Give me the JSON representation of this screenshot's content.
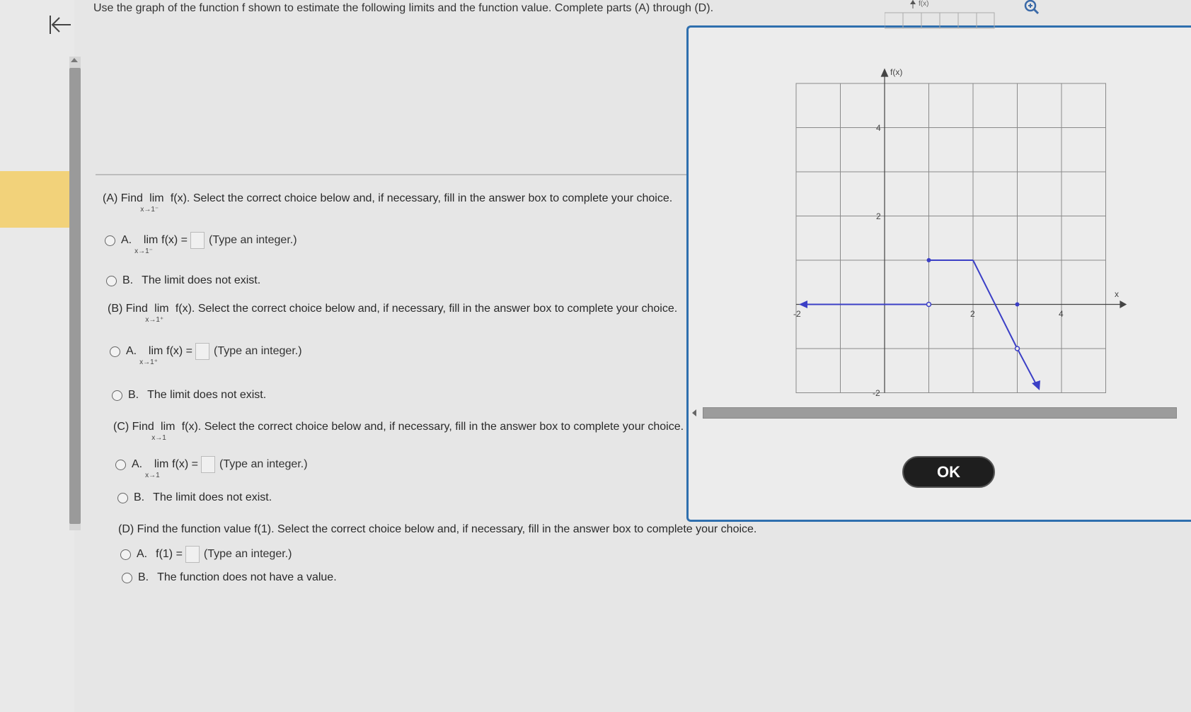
{
  "instruction": "Use the graph of the function f shown to estimate the following limits and the function value. Complete parts (A) through (D).",
  "parts": [
    {
      "prompt_pre": "(A) Find",
      "lim": "lim",
      "func": "f(x).",
      "sub": "x→1⁻",
      "prompt_post": "Select the correct choice below and, if necessary, fill in the answer box to complete your choice.",
      "choice_a_letter": "A.",
      "choice_a_lim": "lim",
      "choice_a_func": "f(x) =",
      "choice_a_sub": "x→1⁻",
      "choice_a_hint": "(Type an integer.)",
      "choice_b_letter": "B.",
      "choice_b_text": "The limit does not exist."
    },
    {
      "prompt_pre": "(B) Find",
      "lim": "lim",
      "func": "f(x).",
      "sub": "x→1⁺",
      "prompt_post": "Select the correct choice below and, if necessary, fill in the answer box to complete your choice.",
      "choice_a_letter": "A.",
      "choice_a_lim": "lim",
      "choice_a_func": "f(x) =",
      "choice_a_sub": "x→1⁺",
      "choice_a_hint": "(Type an integer.)",
      "choice_b_letter": "B.",
      "choice_b_text": "The limit does not exist."
    },
    {
      "prompt_pre": "(C) Find",
      "lim": "lim",
      "func": "f(x).",
      "sub": "x→1",
      "prompt_post": "Select the correct choice below and, if necessary, fill in the answer box to complete your choice.",
      "choice_a_letter": "A.",
      "choice_a_lim": "lim",
      "choice_a_func": "f(x) =",
      "choice_a_sub": "x→1",
      "choice_a_hint": "(Type an integer.)",
      "choice_b_letter": "B.",
      "choice_b_text": "The limit does not exist."
    },
    {
      "prompt_pre": "(D) Find the function value f(1).",
      "prompt_post": "Select the correct choice below and, if necessary, fill in the answer box to complete your choice.",
      "choice_a_letter": "A.",
      "choice_a_func": "f(1) =",
      "choice_a_hint": "(Type an integer.)",
      "choice_b_letter": "B.",
      "choice_b_text": "The function does not have a value."
    }
  ],
  "graph": {
    "y_axis_label": "f(x)",
    "x_axis_label": "x",
    "tick_labels": {
      "x_neg2": "-2",
      "x_2": "2",
      "x_4": "4",
      "y_4": "4",
      "y_2": "2",
      "y_neg2": "-2"
    },
    "line_color": "#3b3fc6",
    "grid_color": "#8a8a8a"
  },
  "top_mini_label": "f(x)",
  "ok_label": "OK",
  "colors": {
    "panel_border": "#2f6fae",
    "highlight": "#f2d27a"
  }
}
